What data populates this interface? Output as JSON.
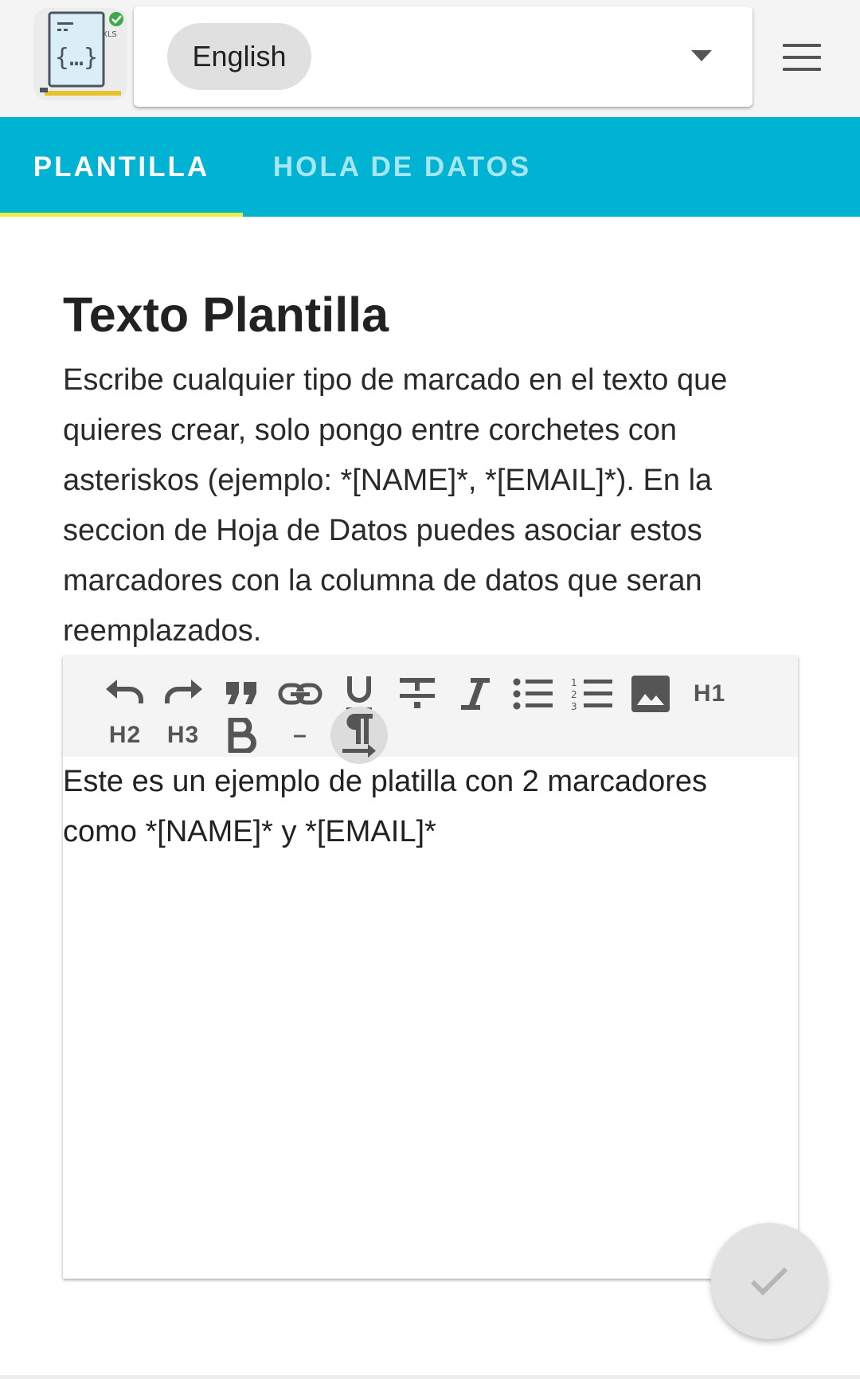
{
  "header": {
    "language_selected": "English",
    "icons": {
      "logo": "xls-template-logo-icon",
      "caret": "dropdown-caret-icon",
      "menu": "hamburger-menu-icon"
    }
  },
  "tabs": [
    {
      "label": "PLANTILLA",
      "active": true
    },
    {
      "label": "HOLA DE DATOS",
      "active": false
    }
  ],
  "main": {
    "title": "Texto Plantilla",
    "description": "Escribe cualquier tipo de marcado en el texto que quieres crear, solo pongo entre corchetes con asteriskos (ejemplo: *[NAME]*, *[EMAIL]*). En la seccion de Hoja de Datos puedes asociar estos marcadores con la columna de datos que seran reemplazados."
  },
  "editor": {
    "toolbar": {
      "h1": "H1",
      "h2": "H2",
      "h3": "H3",
      "dash": "–",
      "icons": [
        "undo-icon",
        "redo-icon",
        "quote-icon",
        "link-icon",
        "underline-icon",
        "strikethrough-icon",
        "italic-icon",
        "bullet-list-icon",
        "numbered-list-icon",
        "image-icon",
        "bold-icon",
        "paragraph-direction-icon"
      ]
    },
    "content": "Este es un ejemplo de platilla con 2 marcadores como *[NAME]* y *[EMAIL]*"
  },
  "fab": {
    "icon": "check-icon"
  },
  "colors": {
    "tab_bar": "#00b3d2",
    "tab_indicator": "#e8ef3e",
    "toolbar_bg": "#f4f4f4"
  }
}
